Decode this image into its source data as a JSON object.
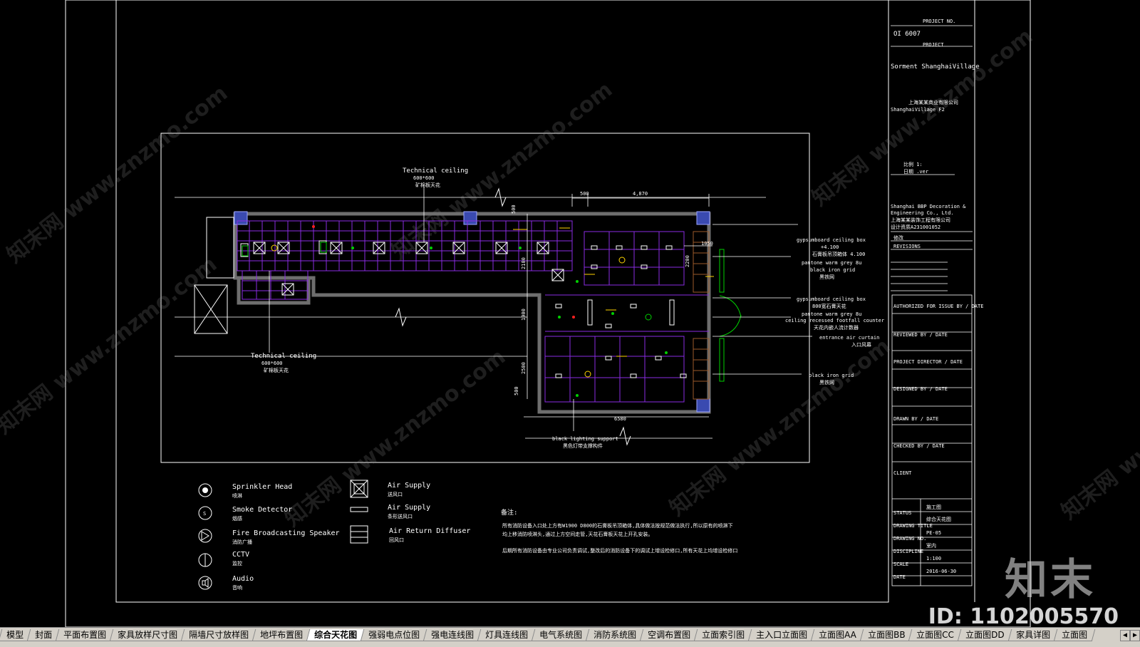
{
  "title_block": {
    "project_no_label": "PROJECT NO.",
    "project_no": "OI 6007",
    "project_label": "PROJECT",
    "project_name": "Sorment ShanghaiVillage",
    "client_small_1": "上海某某商业有限公司",
    "client_small_2": "ShanghaiVillage F2",
    "scale_label": "比例 1:",
    "date_label": "日期 .ver",
    "company_1": "Shanghai BBP Decoration &",
    "company_2": "Engineering Co., Ltd.",
    "company_cn_1": "上海某某装饰工程有限公司",
    "company_cn_2": "设计资质A231001052",
    "revisions_cn": "修改",
    "revisions": "REVISIONS",
    "authorized": "AUTHORIZED FOR ISSUE BY / DATE",
    "reviewed": "REVIEWED BY / DATE",
    "director": "PROJECT DIRECTOR / DATE",
    "designed": "DESIGNED BY / DATE",
    "drawn": "DRAWN BY / DATE",
    "checked": "CHECKED BY / DATE",
    "client": "CLIENT",
    "status_label": "STATUS",
    "status_value": "施工图",
    "drawing_title_label": "DRAWING TITLE",
    "drawing_title_value": "综合天花图",
    "drawing_no_label": "DRAWING NO.",
    "drawing_no_value": "PE-05",
    "discipline_label": "DISCIPLINE",
    "discipline_value": "室内",
    "scale_label2": "SCALE",
    "scale_value": "1:100",
    "date_label2": "DATE",
    "date_value": "2016-06-30"
  },
  "plan": {
    "tech_ceiling_top_1": "Technical ceiling",
    "tech_ceiling_top_2": "600*600",
    "tech_ceiling_top_3": "矿棉板天花",
    "tech_ceiling_bottom_1": "Technical ceiling",
    "tech_ceiling_bottom_2": "600*600",
    "tech_ceiling_bottom_3": "矿棉板天花",
    "dim_top_500": "500",
    "dim_top_4870": "4,870",
    "dim_right_1050": "1050",
    "dim_vert_500": "500",
    "dim_vert_2100": "2100",
    "dim_vert_1900": "1900",
    "dim_vert_2200": "2200",
    "dim_vert_2500": "2500",
    "dim_vert_500b": "500",
    "dim_bottom_6580": "6580",
    "black_lighting_1": "black lighting support",
    "black_lighting_2": "黑色灯带支撑构件",
    "note1_1": "gypsumboard ceiling box",
    "note1_2": "+4.100",
    "note1_3": "石膏板吊顶箱体 4.100",
    "note1_4": "pantone warm grey 8u",
    "note1_5": "black iron grid",
    "note1_6": "黑铁网",
    "note2_1": "gypsumboard ceiling box",
    "note2_2": "800宽石膏天花",
    "note2_3": "pantone warm grey 8u",
    "note2_4": "ceiling recessed footfall counter",
    "note2_5": "天花内嵌人流计数器",
    "note3_1": "entrance air curtain",
    "note3_2": "入口风幕",
    "note4_1": "black iron grid",
    "note4_2": "黑铁网"
  },
  "legend": [
    {
      "icon": "sprinkler-head-icon",
      "en": "Sprinkler Head",
      "cn": "喷淋"
    },
    {
      "icon": "smoke-detector-icon",
      "en": "Smoke Detector",
      "cn": "烟感"
    },
    {
      "icon": "fire-speaker-icon",
      "en": "Fire Broadcasting Speaker",
      "cn": "消防广播"
    },
    {
      "icon": "cctv-icon",
      "en": "CCTV",
      "cn": "监控"
    },
    {
      "icon": "audio-icon",
      "en": "Audio",
      "cn": "音响"
    },
    {
      "icon": "air-supply-square-icon",
      "en": "Air Supply",
      "cn": "送风口"
    },
    {
      "icon": "air-supply-linear-icon",
      "en": "Air Supply",
      "cn": "条形送风口"
    },
    {
      "icon": "air-return-diffuser-icon",
      "en": "Air Return Diffuser",
      "cn": "回风口"
    }
  ],
  "notes": {
    "heading": "备注:",
    "line1": "所有消防设备入口处上方有W1900 D800的石膏板吊顶箱体,具体做法按规范做法执行,所以原有的喷淋下",
    "line2": "均上移消防喷淋头,通过上方空间走管,天花石膏板天花上开孔安装。",
    "line3": "后期所有消防设备由专业公司负责调试,整改后的消防设备下的调试上增设检修口,所有天花上均增设检修口"
  },
  "tabs": [
    "模型",
    "封面",
    "平面布置图",
    "家具放样尺寸图",
    "隔墙尺寸放样图",
    "地坪布置图",
    "综合天花图",
    "强弱电点位图",
    "强电连线图",
    "灯具连线图",
    "电气系统图",
    "消防系统图",
    "空调布置图",
    "立面索引图",
    "主入口立面图",
    "立面图AA",
    "立面图BB",
    "立面图CC",
    "立面图DD",
    "家具详图",
    "立面图"
  ],
  "active_tab": "综合天花图",
  "watermarks": {
    "site": "知末网 www.znzmo.com",
    "logo": "知末",
    "id": "ID: 1102005570"
  },
  "colors": {
    "grid": "#8a2be2",
    "wall": "#6e6e6e",
    "accent_yellow": "#ffd400",
    "accent_green": "#00d000",
    "column_blue": "#3a4ab0"
  }
}
